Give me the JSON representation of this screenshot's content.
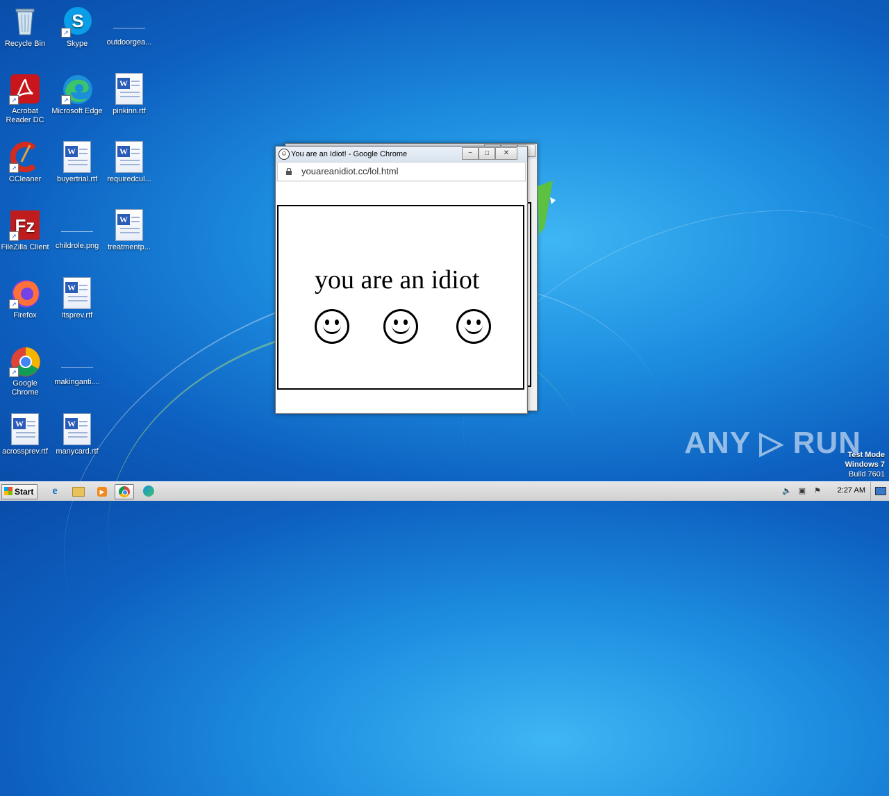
{
  "desktop": {
    "icons": [
      {
        "label": "Recycle Bin",
        "icon": "recycle-bin-icon"
      },
      {
        "label": "Skype",
        "icon": "skype-icon"
      },
      {
        "label": "outdoorgea...",
        "icon": "file-icon"
      },
      {
        "label": "Acrobat Reader DC",
        "icon": "acrobat-icon"
      },
      {
        "label": "Microsoft Edge",
        "icon": "edge-icon"
      },
      {
        "label": "pinkinn.rtf",
        "icon": "word-doc-icon"
      },
      {
        "label": "CCleaner",
        "icon": "ccleaner-icon"
      },
      {
        "label": "buyertrial.rtf",
        "icon": "word-doc-icon"
      },
      {
        "label": "requiredcul...",
        "icon": "word-doc-icon"
      },
      {
        "label": "FileZilla Client",
        "icon": "filezilla-icon"
      },
      {
        "label": "childrole.png",
        "icon": "image-file-icon"
      },
      {
        "label": "treatmentp...",
        "icon": "word-doc-icon"
      },
      {
        "label": "Firefox",
        "icon": "firefox-icon"
      },
      {
        "label": "itsprev.rtf",
        "icon": "word-doc-icon"
      },
      {
        "label": "Google Chrome",
        "icon": "chrome-icon"
      },
      {
        "label": "makinganti....",
        "icon": "file-icon"
      },
      {
        "label": "acrossprev.rtf",
        "icon": "word-doc-icon"
      },
      {
        "label": "manycard.rtf",
        "icon": "word-doc-icon"
      }
    ]
  },
  "popup": {
    "title": "You are an Idiot! - Google Chrome",
    "url": "youareanidiot.cc/lol.html",
    "message": "you are an idiot",
    "minimize": "−",
    "maximize": "□",
    "close": "✕"
  },
  "taskbar": {
    "start_label": "Start",
    "clock": "2:27 AM"
  },
  "watermark": {
    "brand": "ANY ▷ RUN",
    "line1": "Test Mode",
    "line2": "Windows 7",
    "line3": "Build 7601"
  }
}
